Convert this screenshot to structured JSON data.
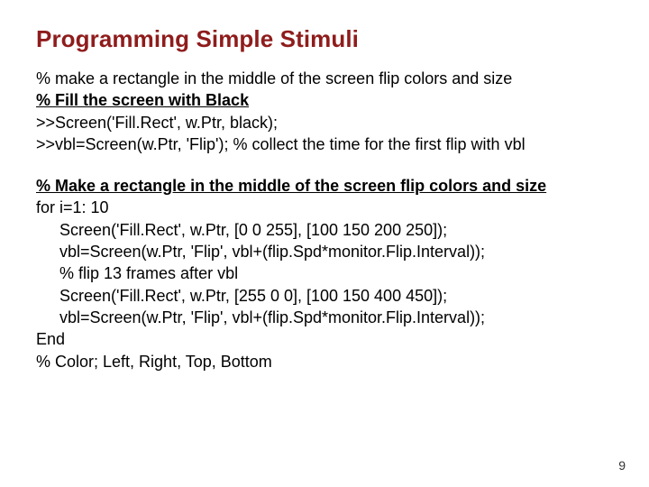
{
  "title": "Programming Simple Stimuli",
  "l1": "% make a rectangle in the middle of the screen flip colors and size",
  "l2": "% Fill the screen with Black",
  "l3": ">>Screen('Fill.Rect', w.Ptr, black);",
  "l4": ">>vbl=Screen(w.Ptr, 'Flip'); % collect the time for the first flip with vbl",
  "l5": "% Make a rectangle in the middle of the screen flip colors and size",
  "l6": "for i=1: 10",
  "l7": "Screen('Fill.Rect', w.Ptr, [0 0 255], [100 150 200 250]);",
  "l8": "vbl=Screen(w.Ptr, 'Flip', vbl+(flip.Spd*monitor.Flip.Interval));",
  "l9": "% flip 13 frames after vbl",
  "l10": "Screen('Fill.Rect', w.Ptr, [255 0 0], [100 150 400 450]);",
  "l11": "vbl=Screen(w.Ptr, 'Flip', vbl+(flip.Spd*monitor.Flip.Interval));",
  "l12": "End",
  "l13": "% Color; Left, Right, Top, Bottom",
  "pagenum": "9"
}
